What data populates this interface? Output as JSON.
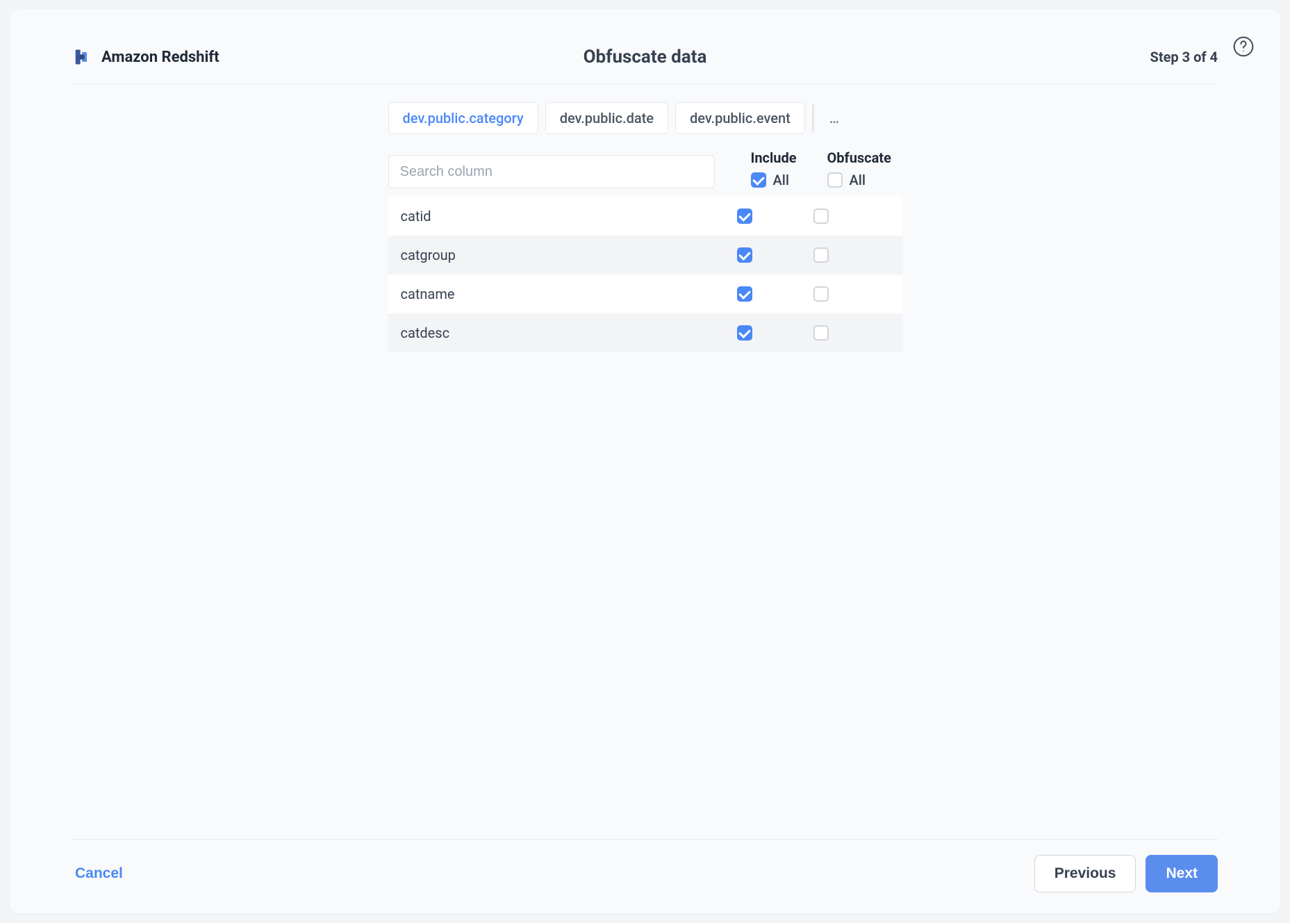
{
  "header": {
    "source_label": "Amazon Redshift",
    "page_title": "Obfuscate data",
    "step_indicator": "Step 3 of 4"
  },
  "tabs": [
    {
      "label": "dev.public.category",
      "active": true
    },
    {
      "label": "dev.public.date",
      "active": false
    },
    {
      "label": "dev.public.event",
      "active": false
    }
  ],
  "more_tabs_glyph": "…",
  "search": {
    "placeholder": "Search column"
  },
  "columns": {
    "include": {
      "title": "Include",
      "all_label": "All",
      "all_checked": true
    },
    "obfuscate": {
      "title": "Obfuscate",
      "all_label": "All",
      "all_checked": false
    }
  },
  "rows": [
    {
      "name": "catid",
      "include": true,
      "obfuscate": false
    },
    {
      "name": "catgroup",
      "include": true,
      "obfuscate": false
    },
    {
      "name": "catname",
      "include": true,
      "obfuscate": false
    },
    {
      "name": "catdesc",
      "include": true,
      "obfuscate": false
    }
  ],
  "footer": {
    "cancel_label": "Cancel",
    "previous_label": "Previous",
    "next_label": "Next"
  }
}
